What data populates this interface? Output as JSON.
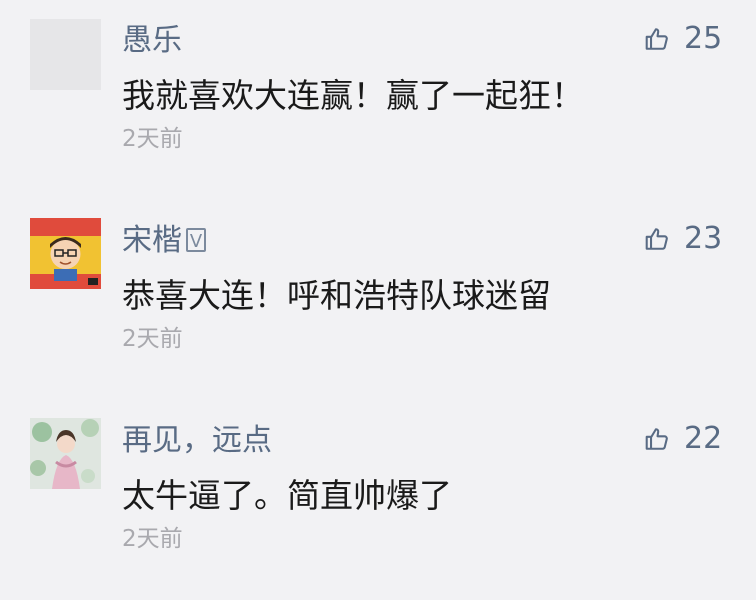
{
  "comments": [
    {
      "user": "愚乐",
      "verified": false,
      "text": "我就喜欢大连赢！赢了一起狂！",
      "time": "2天前",
      "likes": "25"
    },
    {
      "user": "宋楷",
      "verified": true,
      "verified_mark": "V",
      "text": "恭喜大连！呼和浩特队球迷留",
      "time": "2天前",
      "likes": "23"
    },
    {
      "user": "再见，远点",
      "verified": false,
      "text": "太牛逼了。简直帅爆了",
      "time": "2天前",
      "likes": "22"
    }
  ],
  "icons": {
    "like": "thumbs-up-outline"
  },
  "colors": {
    "background": "#f2f2f4",
    "name": "#596b84",
    "text": "#1a1a1a",
    "time": "#a9a9ae",
    "like": "#596b84"
  }
}
